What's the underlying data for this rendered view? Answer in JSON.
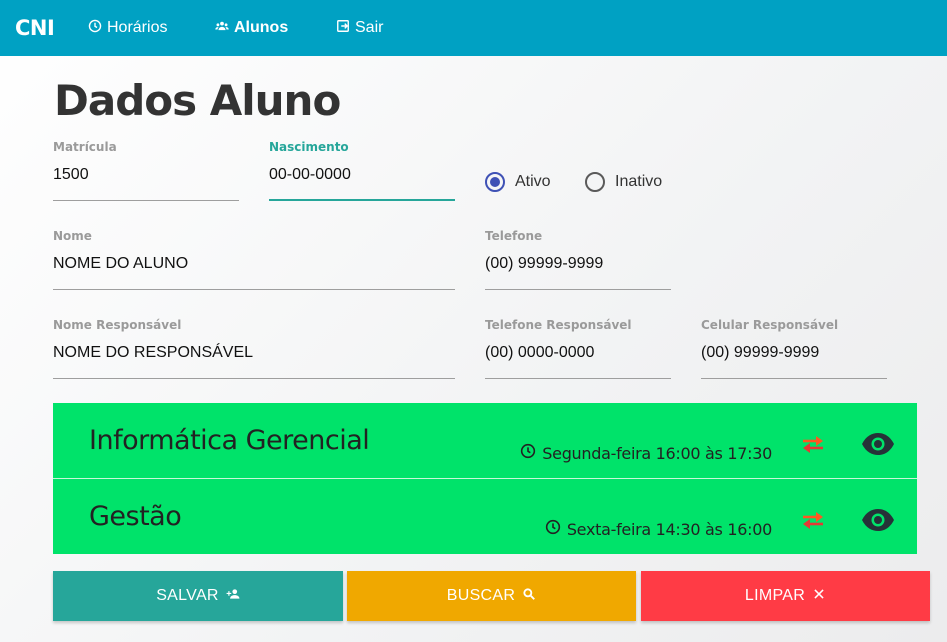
{
  "nav": {
    "brand": "CNI",
    "items": [
      {
        "label": "Horários",
        "icon": "clock-icon"
      },
      {
        "label": "Alunos",
        "icon": "people-icon"
      },
      {
        "label": "Sair",
        "icon": "exit-icon"
      }
    ],
    "active": "Alunos",
    "background": "#00a1c3"
  },
  "page": {
    "title": "Dados Aluno"
  },
  "form": {
    "matricula": {
      "label": "Matrícula",
      "value": "1500"
    },
    "nascimento": {
      "label": "Nascimento",
      "value": "00-00-0000"
    },
    "status": {
      "options": [
        "Ativo",
        "Inativo"
      ],
      "selected": "Ativo"
    },
    "nome": {
      "label": "Nome",
      "value": "NOME DO ALUNO"
    },
    "telefone": {
      "label": "Telefone",
      "value": "(00) 99999-9999"
    },
    "nome_responsavel": {
      "label": "Nome Responsável",
      "value": "NOME DO RESPONSÁVEL"
    },
    "telefone_responsavel": {
      "label": "Telefone Responsável",
      "value": "(00) 0000-0000"
    },
    "celular_responsavel": {
      "label": "Celular Responsável",
      "value": "(00) 99999-9999"
    }
  },
  "courses": [
    {
      "name": "Informática Gerencial",
      "schedule": "Segunda-feira 16:00 às 17:30"
    },
    {
      "name": "Gestão",
      "schedule": "Sexta-feira 14:30 às 16:00"
    }
  ],
  "colors": {
    "course_bg": "#00e36a",
    "save": "#26a69a",
    "search": "#f0a800",
    "clear": "#ff3b45",
    "accent": "#26a69a",
    "radio": "#3f51b5"
  },
  "buttons": {
    "save": "SALVAR",
    "search": "BUSCAR",
    "clear": "LIMPAR"
  }
}
